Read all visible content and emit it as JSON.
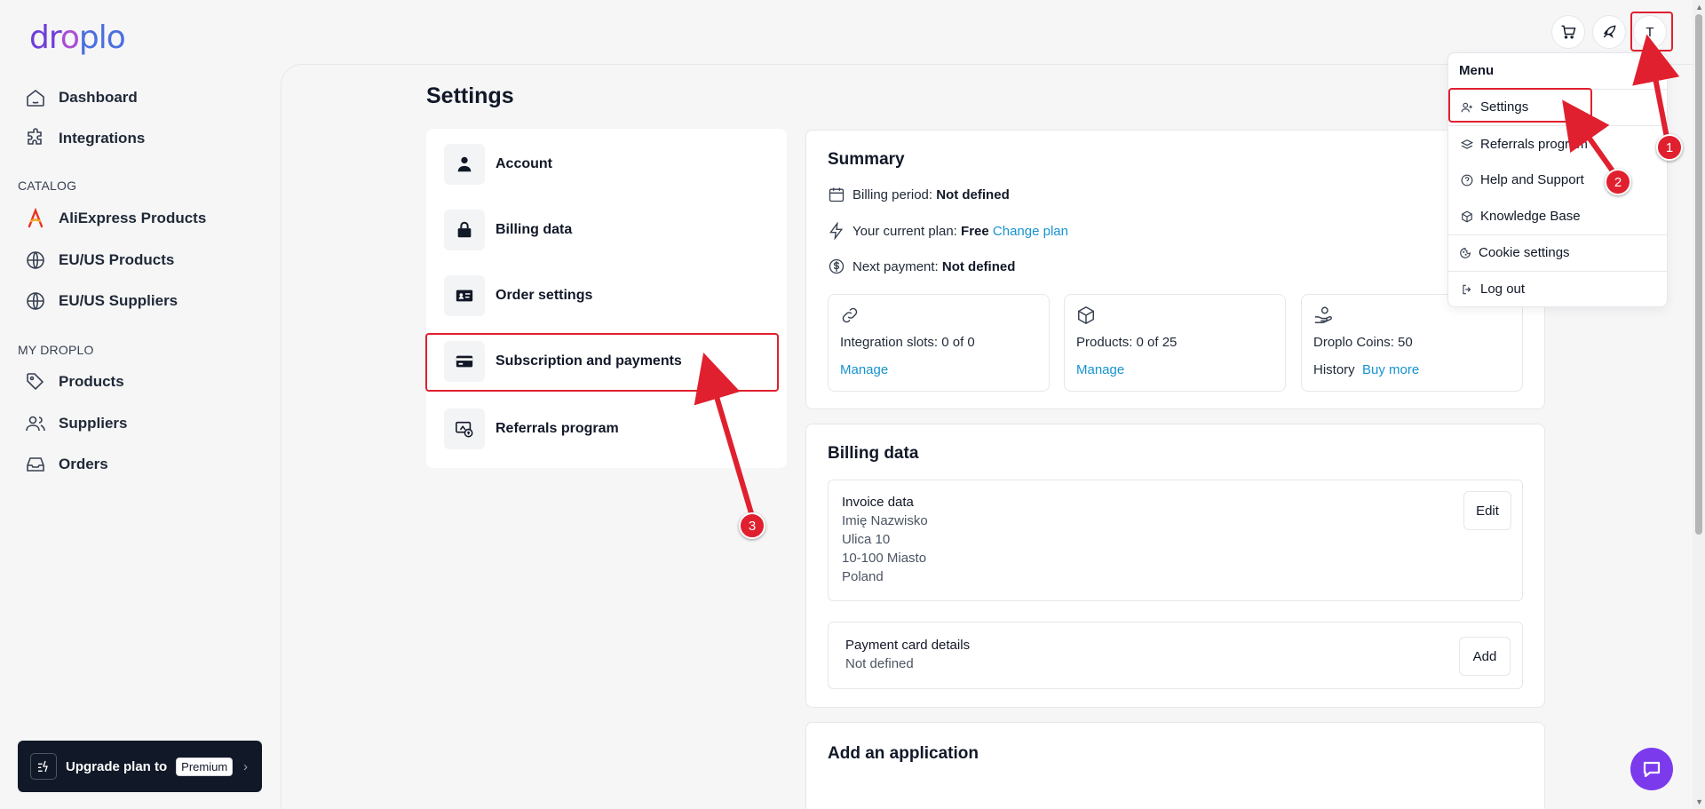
{
  "logo": {
    "part1": "dr",
    "part2": "o",
    "part3": "plo"
  },
  "sidebar": {
    "items": [
      {
        "label": "Dashboard",
        "icon": "home-icon"
      },
      {
        "label": "Integrations",
        "icon": "puzzle-icon"
      }
    ],
    "catalog_label": "CATALOG",
    "catalog_items": [
      {
        "label": "AliExpress Products",
        "icon": "aliexpress-icon"
      },
      {
        "label": "EU/US Products",
        "icon": "globe-icon"
      },
      {
        "label": "EU/US Suppliers",
        "icon": "globe-icon"
      }
    ],
    "mydroplo_label": "MY DROPLO",
    "mydroplo_items": [
      {
        "label": "Products",
        "icon": "tag-icon"
      },
      {
        "label": "Suppliers",
        "icon": "users-icon"
      },
      {
        "label": "Orders",
        "icon": "inbox-icon"
      }
    ],
    "upgrade": {
      "label": "Upgrade plan to",
      "badge": "Premium"
    }
  },
  "page_title": "Settings",
  "settings_nav": [
    {
      "label": "Account",
      "icon": "user-icon"
    },
    {
      "label": "Billing data",
      "icon": "lock-icon"
    },
    {
      "label": "Order settings",
      "icon": "id-card-icon"
    },
    {
      "label": "Subscription and payments",
      "icon": "credit-card-icon"
    },
    {
      "label": "Referrals program",
      "icon": "referral-icon"
    }
  ],
  "summary": {
    "title": "Summary",
    "billing_period_label": "Billing period:",
    "billing_period_value": "Not defined",
    "current_plan_label": "Your current plan:",
    "current_plan_value": "Free",
    "change_plan": "Change plan",
    "next_payment_label": "Next payment:",
    "next_payment_value": "Not defined",
    "stats": [
      {
        "label": "Integration slots: 0 of 0",
        "link": "Manage"
      },
      {
        "label": "Products: 0 of 25",
        "link": "Manage"
      },
      {
        "label": "Droplo Coins: 50",
        "history": "History",
        "link": "Buy more"
      }
    ]
  },
  "billing": {
    "title": "Billing data",
    "invoice_title": "Invoice data",
    "invoice_lines": [
      "Imię Nazwisko",
      "Ulica 10",
      "10-100 Miasto",
      "Poland"
    ],
    "edit_label": "Edit",
    "card_title": "Payment card details",
    "card_value": "Not defined",
    "add_label": "Add"
  },
  "add_app": {
    "title": "Add an application"
  },
  "topbar": {
    "avatar_letter": "T"
  },
  "menu": {
    "title": "Menu",
    "items": [
      {
        "label": "Settings",
        "icon": "user-plus-icon"
      },
      {
        "label": "Referrals program",
        "icon": "layers-icon"
      },
      {
        "label": "Help and Support",
        "icon": "help-circle-icon"
      },
      {
        "label": "Knowledge Base",
        "icon": "box-icon"
      },
      {
        "label": "Cookie settings",
        "icon": "cookie-icon"
      },
      {
        "label": "Log out",
        "icon": "logout-icon"
      }
    ]
  },
  "annotations": {
    "m1": "1",
    "m2": "2",
    "m3": "3"
  },
  "colors": {
    "accent": "#1793d1",
    "annotation": "#e0202f",
    "chat": "#7c3aed"
  }
}
